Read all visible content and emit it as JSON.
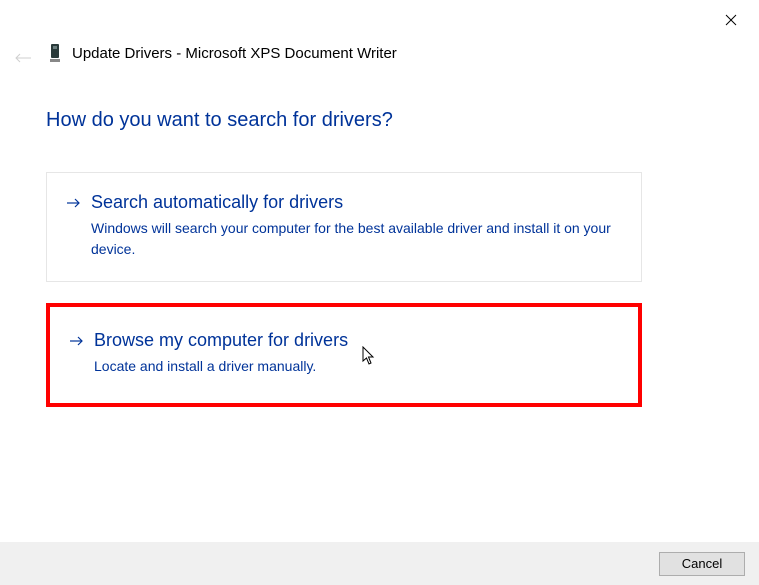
{
  "window": {
    "title": "Update Drivers - Microsoft XPS Document Writer"
  },
  "heading": "How do you want to search for drivers?",
  "options": {
    "auto": {
      "title": "Search automatically for drivers",
      "desc": "Windows will search your computer for the best available driver and install it on your device."
    },
    "browse": {
      "title": "Browse my computer for drivers",
      "desc": "Locate and install a driver manually."
    }
  },
  "buttons": {
    "cancel": "Cancel"
  }
}
